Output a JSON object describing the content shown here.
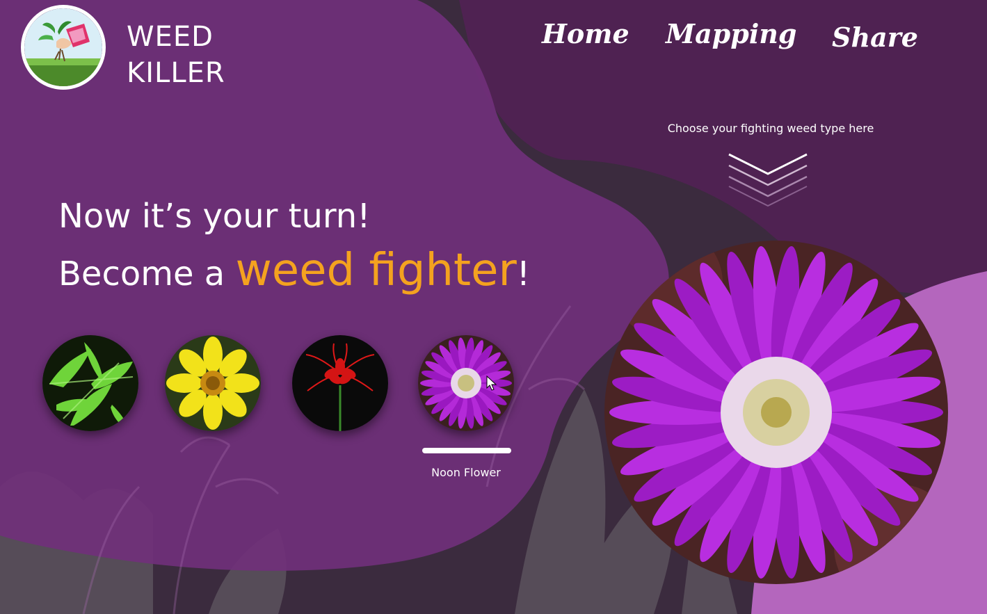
{
  "brand": {
    "line1": "WEED",
    "line2": "KILLER",
    "logo_icon": "hand-pulling-weed-logo"
  },
  "nav": {
    "home": "Home",
    "mapping": "Mapping",
    "share": "Share"
  },
  "hint": {
    "text": "Choose your fighting weed type here",
    "icon": "triple-chevron-down-icon"
  },
  "headline": {
    "line1": "Now it’s your turn!",
    "prefix": "Become a ",
    "accent": "weed fighter",
    "suffix": "!"
  },
  "weeds": [
    {
      "icon": "fern-weed-image"
    },
    {
      "icon": "yellow-daisy-weed-image"
    },
    {
      "icon": "red-spider-lily-image"
    },
    {
      "icon": "purple-noon-flower-image",
      "selected": true
    }
  ],
  "selected_weed": {
    "name": "Noon Flower",
    "icon": "noon-flower-large-image"
  },
  "colors": {
    "purple_dark": "#5e2564",
    "purple_mid": "#7a3a82",
    "lilac": "#b466bd",
    "accent_orange": "#f4a21f",
    "text": "#ffffff"
  }
}
